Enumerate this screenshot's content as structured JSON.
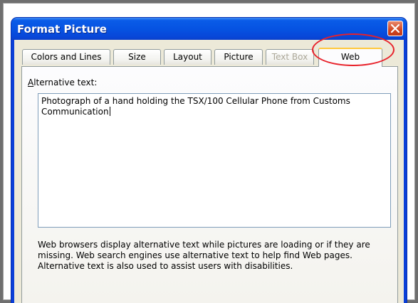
{
  "dialog": {
    "title": "Format Picture",
    "tabs": [
      {
        "label": "Colors and Lines",
        "state": "normal"
      },
      {
        "label": "Size",
        "state": "normal"
      },
      {
        "label": "Layout",
        "state": "normal"
      },
      {
        "label": "Picture",
        "state": "normal"
      },
      {
        "label": "Text Box",
        "state": "disabled"
      },
      {
        "label": "Web",
        "state": "active"
      }
    ],
    "alt_text": {
      "label_accesskey": "A",
      "label_rest": "lternative text:",
      "value": "Photograph of a hand holding the TSX/100 Cellular Phone from Customs Communication"
    },
    "help_text": "Web browsers display alternative text while pictures are loading or if they are missing.  Web search engines use alternative text to help find Web pages.  Alternative text is also used to assist users with disabilities."
  },
  "annotation": {
    "shape": "ellipse",
    "color": "#e8212a"
  },
  "colors": {
    "titlebar": "#0653e2",
    "dialog_bg": "#ece9d8",
    "close_button": "#d24722",
    "active_tab_highlight": "#ffc83c"
  }
}
